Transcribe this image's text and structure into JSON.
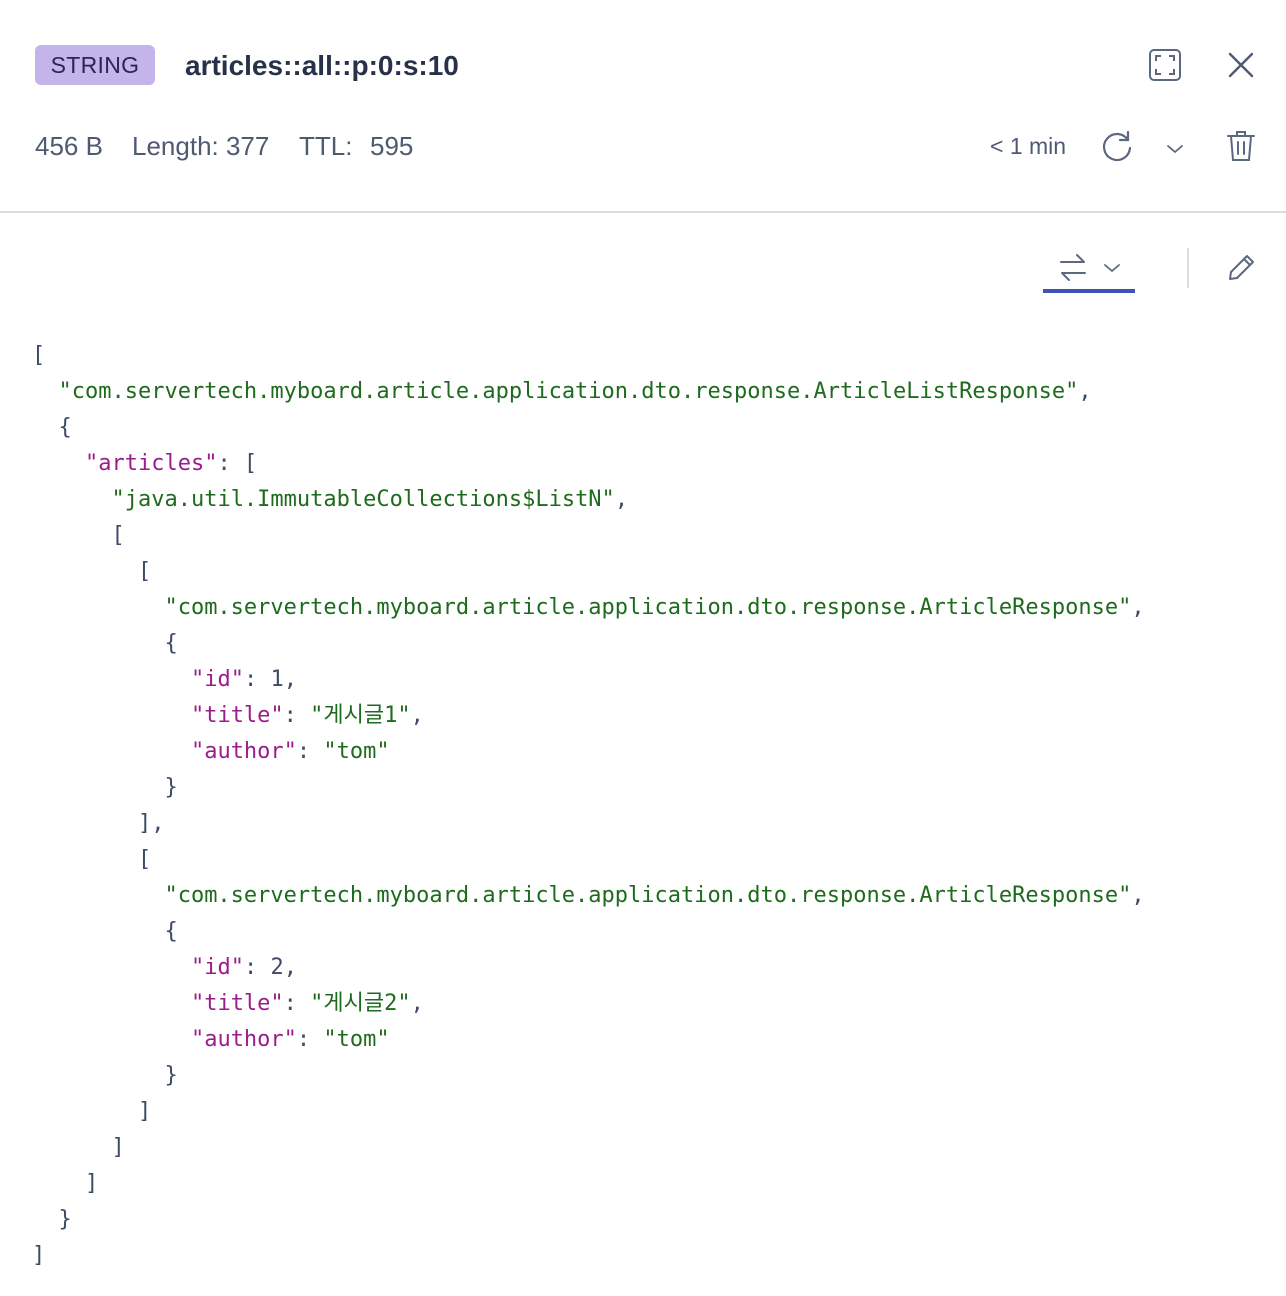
{
  "header": {
    "type_badge": "STRING",
    "key_name": "articles::all::p:0:s:10",
    "size": "456 B",
    "length": "Length: 377",
    "ttl_label": "TTL:",
    "ttl_value": "595",
    "refresh_time": "< 1 min",
    "icons": {
      "expand": "fullscreen-icon",
      "close": "close-icon",
      "refresh": "refresh-icon",
      "refresh_menu": "chevron-down-icon",
      "delete": "trash-icon"
    }
  },
  "toolbar": {
    "format_icon": "swap-arrows-icon",
    "format_menu_icon": "chevron-down-icon",
    "edit_icon": "pencil-icon",
    "accent_color": "#3f51b5"
  },
  "colors": {
    "badge_bg": "#c5b3ec",
    "json_key": "#9b1c8c",
    "json_string": "#1e6b1e",
    "json_punct": "#3d4b66"
  },
  "value_lines": [
    [
      {
        "t": "p",
        "v": "["
      }
    ],
    [
      {
        "t": "p",
        "v": "  "
      },
      {
        "t": "s",
        "v": "\"com.servertech.myboard.article.application.dto.response.ArticleListResponse\""
      },
      {
        "t": "p",
        "v": ","
      }
    ],
    [
      {
        "t": "p",
        "v": "  {"
      }
    ],
    [
      {
        "t": "p",
        "v": "    "
      },
      {
        "t": "k",
        "v": "\"articles\""
      },
      {
        "t": "p",
        "v": ": ["
      }
    ],
    [
      {
        "t": "p",
        "v": "      "
      },
      {
        "t": "s",
        "v": "\"java.util.ImmutableCollections$ListN\""
      },
      {
        "t": "p",
        "v": ","
      }
    ],
    [
      {
        "t": "p",
        "v": "      ["
      }
    ],
    [
      {
        "t": "p",
        "v": "        ["
      }
    ],
    [
      {
        "t": "p",
        "v": "          "
      },
      {
        "t": "s",
        "v": "\"com.servertech.myboard.article.application.dto.response.ArticleResponse\""
      },
      {
        "t": "p",
        "v": ","
      }
    ],
    [
      {
        "t": "p",
        "v": "          {"
      }
    ],
    [
      {
        "t": "p",
        "v": "            "
      },
      {
        "t": "k",
        "v": "\"id\""
      },
      {
        "t": "p",
        "v": ": "
      },
      {
        "t": "n",
        "v": "1"
      },
      {
        "t": "p",
        "v": ","
      }
    ],
    [
      {
        "t": "p",
        "v": "            "
      },
      {
        "t": "k",
        "v": "\"title\""
      },
      {
        "t": "p",
        "v": ": "
      },
      {
        "t": "s",
        "v": "\"게시글1\""
      },
      {
        "t": "p",
        "v": ","
      }
    ],
    [
      {
        "t": "p",
        "v": "            "
      },
      {
        "t": "k",
        "v": "\"author\""
      },
      {
        "t": "p",
        "v": ": "
      },
      {
        "t": "s",
        "v": "\"tom\""
      }
    ],
    [
      {
        "t": "p",
        "v": "          }"
      }
    ],
    [
      {
        "t": "p",
        "v": "        ],"
      }
    ],
    [
      {
        "t": "p",
        "v": "        ["
      }
    ],
    [
      {
        "t": "p",
        "v": "          "
      },
      {
        "t": "s",
        "v": "\"com.servertech.myboard.article.application.dto.response.ArticleResponse\""
      },
      {
        "t": "p",
        "v": ","
      }
    ],
    [
      {
        "t": "p",
        "v": "          {"
      }
    ],
    [
      {
        "t": "p",
        "v": "            "
      },
      {
        "t": "k",
        "v": "\"id\""
      },
      {
        "t": "p",
        "v": ": "
      },
      {
        "t": "n",
        "v": "2"
      },
      {
        "t": "p",
        "v": ","
      }
    ],
    [
      {
        "t": "p",
        "v": "            "
      },
      {
        "t": "k",
        "v": "\"title\""
      },
      {
        "t": "p",
        "v": ": "
      },
      {
        "t": "s",
        "v": "\"게시글2\""
      },
      {
        "t": "p",
        "v": ","
      }
    ],
    [
      {
        "t": "p",
        "v": "            "
      },
      {
        "t": "k",
        "v": "\"author\""
      },
      {
        "t": "p",
        "v": ": "
      },
      {
        "t": "s",
        "v": "\"tom\""
      }
    ],
    [
      {
        "t": "p",
        "v": "          }"
      }
    ],
    [
      {
        "t": "p",
        "v": "        ]"
      }
    ],
    [
      {
        "t": "p",
        "v": "      ]"
      }
    ],
    [
      {
        "t": "p",
        "v": "    ]"
      }
    ],
    [
      {
        "t": "p",
        "v": "  }"
      }
    ],
    [
      {
        "t": "p",
        "v": "]"
      }
    ]
  ]
}
